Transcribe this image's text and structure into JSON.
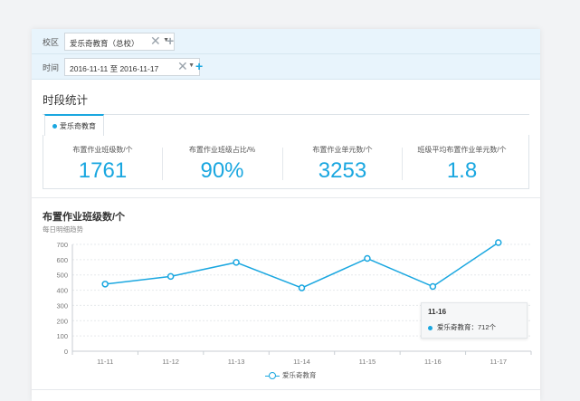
{
  "filters": {
    "campus_label": "校区",
    "campus_value": "爱乐奇教育（总校）",
    "time_label": "时间",
    "time_value": "2016-11-11 至 2016-11-17"
  },
  "section": {
    "title": "时段统计",
    "tab_label": "爱乐奇教育"
  },
  "stats": [
    {
      "label": "布置作业班级数/个",
      "value": "1761"
    },
    {
      "label": "布置作业班级占比/%",
      "value": "90%"
    },
    {
      "label": "布置作业单元数/个",
      "value": "3253"
    },
    {
      "label": "班级平均布置作业单元数/个",
      "value": "1.8"
    }
  ],
  "chart": {
    "title": "布置作业班级数/个",
    "subtitle": "每日明细趋势",
    "tooltip_title": "11-16",
    "tooltip_text": "爱乐奇教育：712个"
  },
  "chart_data": {
    "type": "line",
    "categories": [
      "11-11",
      "11-12",
      "11-13",
      "11-14",
      "11-15",
      "11-16",
      "11-17"
    ],
    "series": [
      {
        "name": "爱乐奇教育",
        "values": [
          440,
          490,
          582,
          415,
          608,
          424,
          712
        ]
      }
    ],
    "ylim": [
      0,
      700
    ],
    "yticks": [
      0,
      100,
      200,
      300,
      400,
      500,
      600,
      700
    ],
    "color": "#1aa7e0",
    "grid": true,
    "legend": "bottom-center"
  },
  "colors": {
    "accent": "#1aa7e0",
    "filter_bg": "#e8f4fc"
  },
  "icons": {
    "remove": "close-icon",
    "add": "plus-icon",
    "dropdown": "caret-down-icon"
  }
}
